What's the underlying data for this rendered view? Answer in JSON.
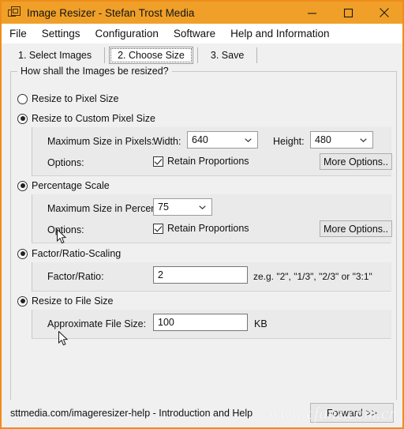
{
  "window": {
    "title": "Image Resizer - Stefan Trost Media",
    "icon": "image-window-icon",
    "controls": {
      "minimize": "minimize-icon",
      "maximize": "maximize-icon",
      "close": "close-icon"
    },
    "titlebar_color": "#f0a028",
    "frame_color": "#ef8c1c"
  },
  "menu": {
    "items": [
      {
        "label": "File"
      },
      {
        "label": "Settings"
      },
      {
        "label": "Configuration"
      },
      {
        "label": "Software"
      },
      {
        "label": "Help and Information"
      }
    ]
  },
  "tabs": {
    "items": [
      {
        "label": "1. Select Images",
        "selected": false
      },
      {
        "label": "2. Choose Size",
        "selected": true
      },
      {
        "label": "3. Save",
        "selected": false
      }
    ]
  },
  "group": {
    "legend": "How shall the Images be resized?"
  },
  "options": {
    "pixel_size": {
      "label": "Resize to Pixel Size",
      "selected": false
    },
    "custom_pixel_size": {
      "label": "Resize to Custom Pixel Size",
      "selected": true,
      "size_label": "Maximum Size in Pixels:",
      "width_label": "Width:",
      "width_value": "640",
      "height_label": "Height:",
      "height_value": "480",
      "options_label": "Options:",
      "retain_label": "Retain Proportions",
      "retain_checked": true,
      "more_options_label": "More Options.."
    },
    "percentage_scale": {
      "label": "Percentage Scale",
      "selected": true,
      "percent_label": "Maximum Size in Percent:",
      "percent_value": "75",
      "options_label": "Options:",
      "retain_label": "Retain Proportions",
      "retain_checked": true,
      "more_options_label": "More Options.."
    },
    "factor_ratio": {
      "label": "Factor/Ratio-Scaling",
      "selected": true,
      "field_label": "Factor/Ratio:",
      "value": "2",
      "hint": "ze.g. \"2\", \"1/3\", \"2/3\" or \"3:1\""
    },
    "file_size": {
      "label": "Resize to File Size",
      "selected": true,
      "field_label": "Approximate File Size:",
      "value": "100",
      "unit": "KB"
    }
  },
  "statusbar": {
    "help_text": "sttmedia.com/imageresizer-help - Introduction and Help",
    "forward_label": "Forward >>"
  },
  "watermark": {
    "text": "www.cfanz.com.cn"
  }
}
